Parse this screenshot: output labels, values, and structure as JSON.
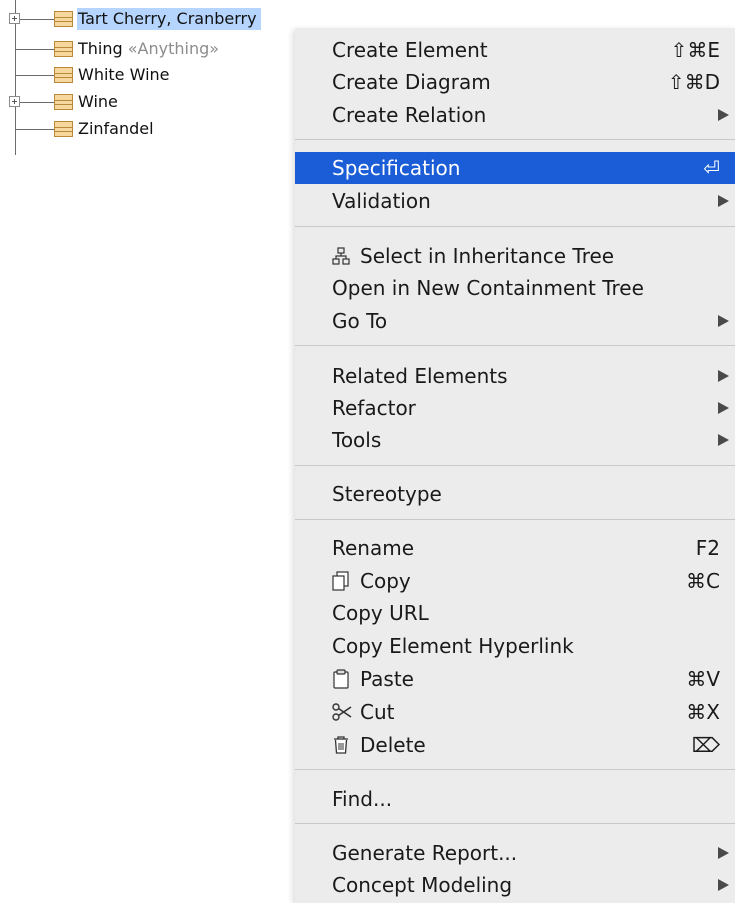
{
  "tree": {
    "items": [
      {
        "label": "Tart Cherry, Cranberry",
        "stereotype": "",
        "expandable": true,
        "selected": true
      },
      {
        "label": "Thing",
        "stereotype": "«Anything»",
        "expandable": false,
        "selected": false
      },
      {
        "label": "White Wine",
        "stereotype": "",
        "expandable": false,
        "selected": false
      },
      {
        "label": "Wine",
        "stereotype": "",
        "expandable": true,
        "selected": false
      },
      {
        "label": "Zinfandel",
        "stereotype": "",
        "expandable": false,
        "selected": false
      }
    ]
  },
  "menu": {
    "create_element": {
      "label": "Create Element",
      "shortcut": "⇧⌘E"
    },
    "create_diagram": {
      "label": "Create Diagram",
      "shortcut": "⇧⌘D"
    },
    "create_relation": {
      "label": "Create Relation"
    },
    "specification": {
      "label": "Specification",
      "shortcut": "⏎"
    },
    "validation": {
      "label": "Validation"
    },
    "select_inheritance": {
      "label": "Select in Inheritance Tree",
      "icon": "hierarchy-icon"
    },
    "open_containment": {
      "label": "Open in New Containment Tree"
    },
    "go_to": {
      "label": "Go To"
    },
    "related_elements": {
      "label": "Related Elements"
    },
    "refactor": {
      "label": "Refactor"
    },
    "tools": {
      "label": "Tools"
    },
    "stereotype": {
      "label": "Stereotype"
    },
    "rename": {
      "label": "Rename",
      "shortcut": "F2"
    },
    "copy": {
      "label": "Copy",
      "shortcut": "⌘C",
      "icon": "copy-icon"
    },
    "copy_url": {
      "label": "Copy URL"
    },
    "copy_hyperlink": {
      "label": "Copy Element Hyperlink"
    },
    "paste": {
      "label": "Paste",
      "shortcut": "⌘V",
      "icon": "paste-icon"
    },
    "cut": {
      "label": "Cut",
      "shortcut": "⌘X",
      "icon": "scissors-icon"
    },
    "delete": {
      "label": "Delete",
      "shortcut": "⌦",
      "icon": "trash-icon"
    },
    "find": {
      "label": "Find..."
    },
    "generate_report": {
      "label": "Generate Report..."
    },
    "concept_modeling": {
      "label": "Concept Modeling"
    }
  },
  "colors": {
    "highlight": "#1a5dd6",
    "menu_bg": "#ececec",
    "tree_selection": "#b5d5ff",
    "class_icon_fill": "#f6d79d"
  }
}
